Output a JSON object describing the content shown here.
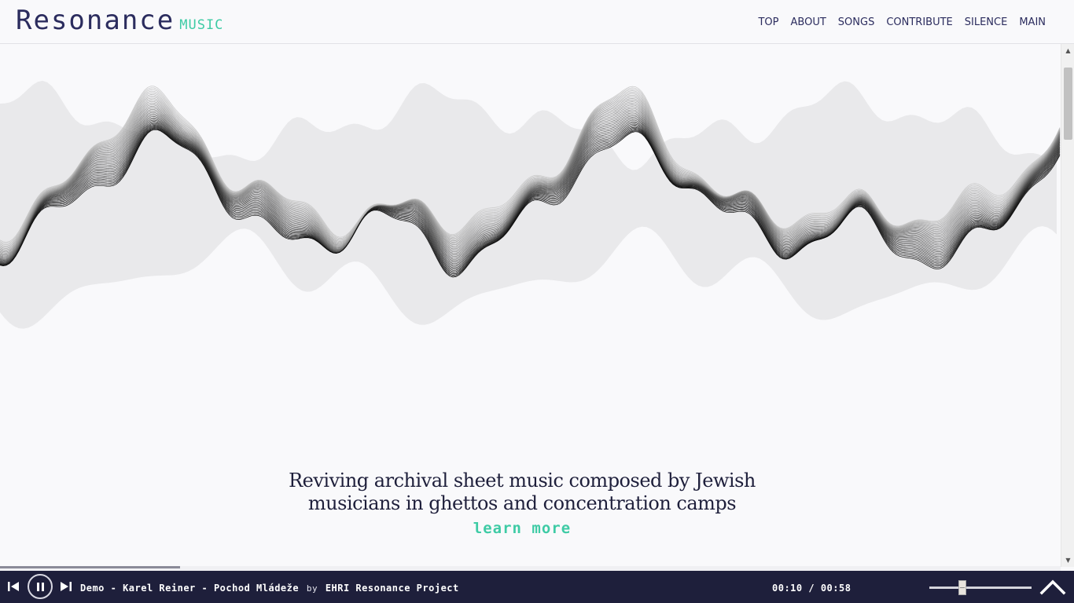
{
  "header": {
    "logo_main": "Resonance",
    "logo_sub": "MUSIC",
    "nav": [
      "TOP",
      "ABOUT",
      "SONGS",
      "CONTRIBUTE",
      "SILENCE",
      "MAIN"
    ]
  },
  "hero": {
    "line1": "Reviving archival sheet music composed by Jewish",
    "line2": "musicians in ghettos and concentration camps",
    "learn_more": "learn more"
  },
  "player": {
    "track_title": "Demo - Karel Reiner - Pochod Mládeže",
    "by_word": "by",
    "artist": "EHRI Resonance Project",
    "current_time": "00:10",
    "separator": "/",
    "total_time": "00:58",
    "progress": 0.17,
    "volume": 0.32
  },
  "colors": {
    "navy": "#2b2c5e",
    "accent": "#3ecba5",
    "player_bg": "#1e1f3b",
    "background": "#f9f9fb"
  },
  "icons": [
    "prev-icon",
    "pause-icon",
    "next-icon",
    "scroll-top-icon",
    "waveform-graphic"
  ]
}
